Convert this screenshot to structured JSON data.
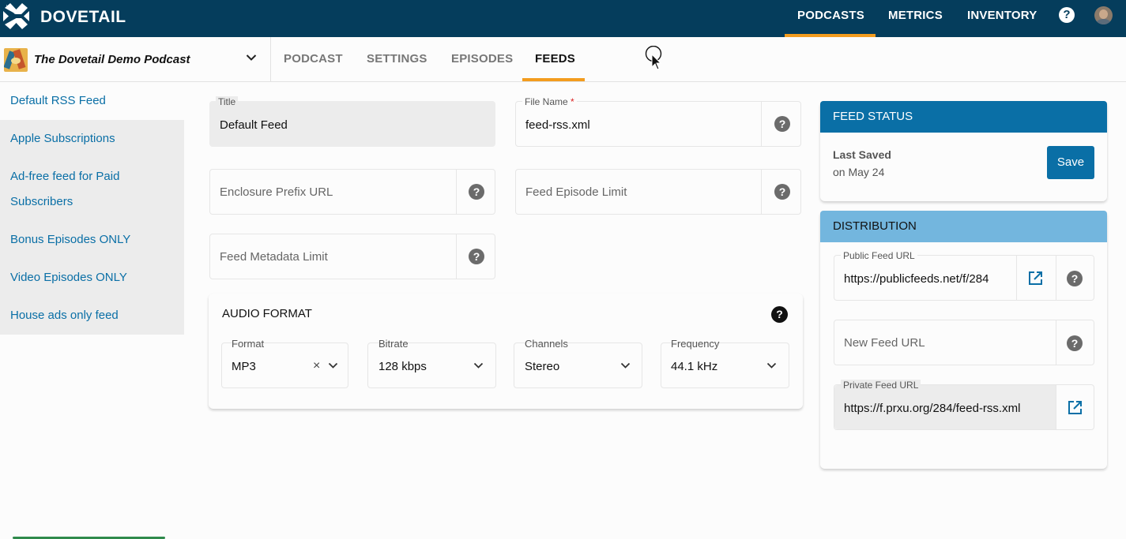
{
  "app": {
    "brand": "DOVETAIL",
    "nav": [
      "PODCASTS",
      "METRICS",
      "INVENTORY"
    ],
    "help_glyph": "?",
    "active_nav": "PODCASTS",
    "accent_color": "#f39c1e",
    "header_color": "#053d5c"
  },
  "podcast": {
    "name": "The Dovetail Demo Podcast",
    "tabs": [
      "PODCAST",
      "SETTINGS",
      "EPISODES",
      "FEEDS"
    ],
    "active_tab": "FEEDS"
  },
  "sidebar": {
    "items": [
      "Default RSS Feed",
      "Apple Subscriptions",
      "Ad-free feed for Paid",
      "Subscribers",
      "Bonus Episodes ONLY",
      "Video Episodes ONLY",
      "House ads only feed"
    ]
  },
  "form": {
    "title_label": "Title",
    "title_value": "Default Feed",
    "file_name_label": "File Name",
    "required_mark": "*",
    "file_name_value": "feed-rss.xml",
    "enclosure_placeholder": "Enclosure Prefix URL",
    "episode_limit_placeholder": "Feed Episode Limit",
    "metadata_limit_placeholder": "Feed Metadata Limit",
    "help_glyph": "?"
  },
  "audio_format": {
    "title": "AUDIO FORMAT",
    "format": {
      "label": "Format",
      "value": "MP3",
      "clear_glyph": "×"
    },
    "bitrate": {
      "label": "Bitrate",
      "value": "128 kbps"
    },
    "channels": {
      "label": "Channels",
      "value": "Stereo"
    },
    "frequency": {
      "label": "Frequency",
      "value": "44.1 kHz"
    }
  },
  "feed_status": {
    "title": "FEED STATUS",
    "last_saved_label": "Last Saved",
    "last_saved_value": "on May 24",
    "save_label": "Save",
    "header_color": "#0a6fa6"
  },
  "distribution": {
    "title": "DISTRIBUTION",
    "header_color": "#73b6de",
    "public_label": "Public Feed URL",
    "public_value": "https://publicfeeds.net/f/284",
    "new_placeholder": "New Feed URL",
    "private_label": "Private Feed URL",
    "private_value": "https://f.prxu.org/284/feed-rss.xml"
  }
}
